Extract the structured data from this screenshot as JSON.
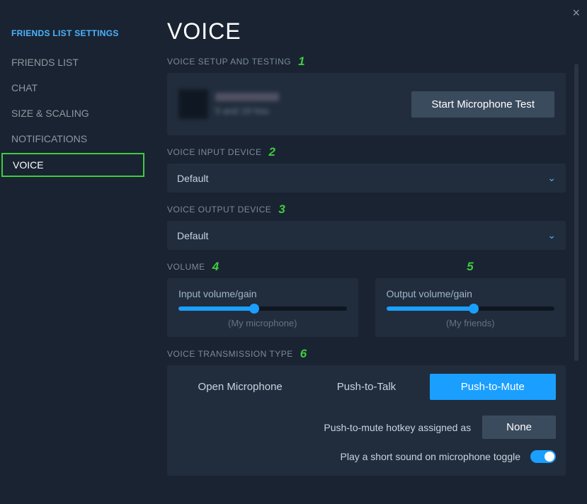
{
  "closeGlyph": "×",
  "sidebar": {
    "title": "FRIENDS LIST SETTINGS",
    "items": [
      {
        "label": "FRIENDS LIST"
      },
      {
        "label": "CHAT"
      },
      {
        "label": "SIZE & SCALING"
      },
      {
        "label": "NOTIFICATIONS"
      },
      {
        "label": "VOICE"
      }
    ]
  },
  "main": {
    "title": "VOICE",
    "sections": {
      "setup": {
        "label": "VOICE SETUP AND TESTING",
        "num": "1",
        "blurText": "5 and 19 hou",
        "testBtn": "Start Microphone Test"
      },
      "input": {
        "label": "VOICE INPUT DEVICE",
        "num": "2",
        "value": "Default",
        "chev": "⌄"
      },
      "output": {
        "label": "VOICE OUTPUT DEVICE",
        "num": "3",
        "value": "Default",
        "chev": "⌄"
      },
      "volume": {
        "label": "VOLUME",
        "num4": "4",
        "num5": "5",
        "inputCard": {
          "title": "Input volume/gain",
          "sub": "(My microphone)",
          "pct": 45
        },
        "outputCard": {
          "title": "Output volume/gain",
          "sub": "(My friends)",
          "pct": 52
        }
      },
      "transmission": {
        "label": "VOICE TRANSMISSION TYPE",
        "num": "6",
        "options": [
          "Open Microphone",
          "Push-to-Talk",
          "Push-to-Mute"
        ],
        "hotkeyLabel": "Push-to-mute hotkey assigned as",
        "hotkeyValue": "None",
        "toggleLabel": "Play a short sound on microphone toggle"
      }
    }
  }
}
